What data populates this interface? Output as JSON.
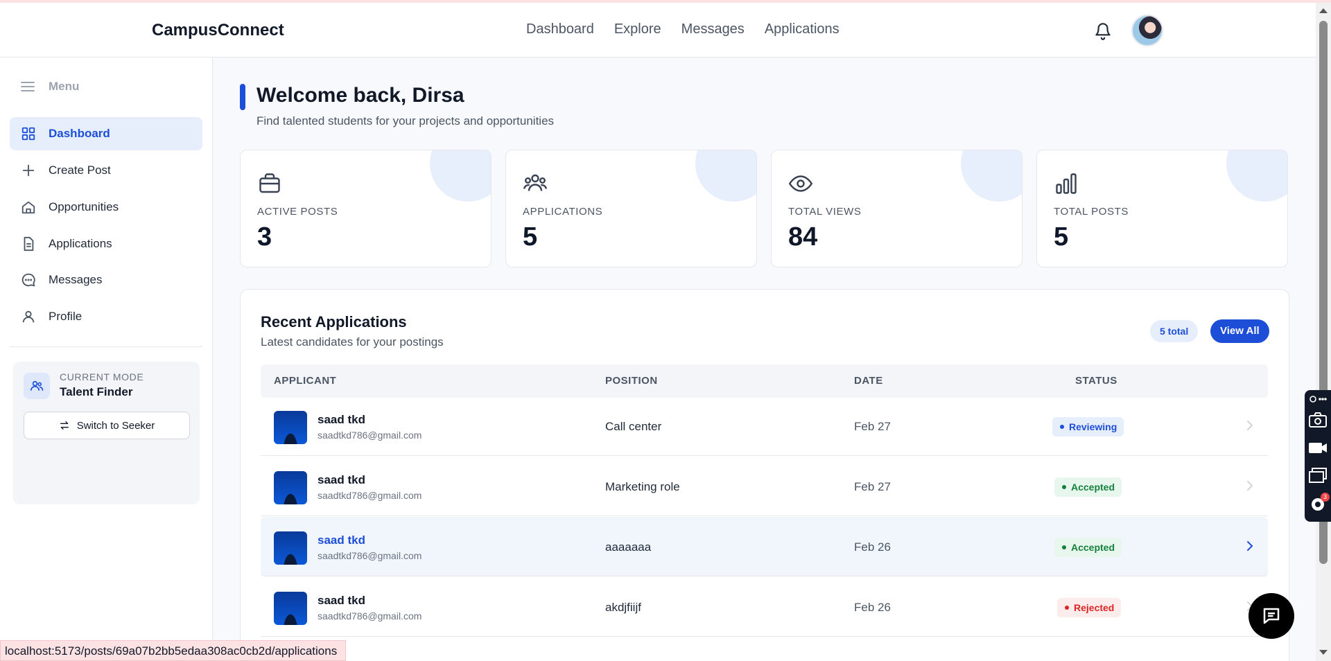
{
  "header": {
    "brand": "CampusConnect",
    "nav": [
      "Dashboard",
      "Explore",
      "Messages",
      "Applications"
    ]
  },
  "sidebar": {
    "menu_label": "Menu",
    "items": [
      {
        "label": "Dashboard",
        "icon": "grid-icon",
        "active": true
      },
      {
        "label": "Create Post",
        "icon": "plus-icon"
      },
      {
        "label": "Opportunities",
        "icon": "home-icon"
      },
      {
        "label": "Applications",
        "icon": "file-icon"
      },
      {
        "label": "Messages",
        "icon": "chat-bubble-icon"
      },
      {
        "label": "Profile",
        "icon": "user-icon"
      }
    ],
    "mode": {
      "label": "CURRENT MODE",
      "value": "Talent Finder",
      "switch_label": "Switch to Seeker"
    }
  },
  "main": {
    "welcome": "Welcome back, Dirsa",
    "subtitle": "Find talented students for your projects and opportunities",
    "stats": [
      {
        "label": "ACTIVE POSTS",
        "value": "3",
        "icon": "briefcase-icon"
      },
      {
        "label": "APPLICATIONS",
        "value": "5",
        "icon": "users-icon"
      },
      {
        "label": "TOTAL VIEWS",
        "value": "84",
        "icon": "eye-icon"
      },
      {
        "label": "TOTAL POSTS",
        "value": "5",
        "icon": "bar-chart-icon"
      }
    ],
    "recent": {
      "title": "Recent Applications",
      "subtitle": "Latest candidates for your postings",
      "total_badge": "5 total",
      "view_all": "View All",
      "columns": [
        "APPLICANT",
        "POSITION",
        "DATE",
        "STATUS"
      ],
      "rows": [
        {
          "name": "saad tkd",
          "email": "saadtkd786@gmail.com",
          "position": "Call center",
          "date": "Feb 27",
          "status": "Reviewing"
        },
        {
          "name": "saad tkd",
          "email": "saadtkd786@gmail.com",
          "position": "Marketing role",
          "date": "Feb 27",
          "status": "Accepted"
        },
        {
          "name": "saad tkd",
          "email": "saadtkd786@gmail.com",
          "position": "aaaaaaa",
          "date": "Feb 26",
          "status": "Accepted"
        },
        {
          "name": "saad tkd",
          "email": "saadtkd786@gmail.com",
          "position": "akdjfiijf",
          "date": "Feb 26",
          "status": "Rejected"
        }
      ]
    }
  },
  "status_colors": {
    "Reviewing": {
      "fg": "#1d4ed8",
      "bg": "#e6eefc"
    },
    "Accepted": {
      "fg": "#15803d",
      "bg": "#e8f7ee"
    },
    "Rejected": {
      "fg": "#dc2626",
      "bg": "#fdecec"
    }
  },
  "accent": "#1d4ed8",
  "statusbar_url": "localhost:5173/posts/69a07b2bb5edaa308ac0cb2d/applications",
  "tool_badge_count": "3"
}
